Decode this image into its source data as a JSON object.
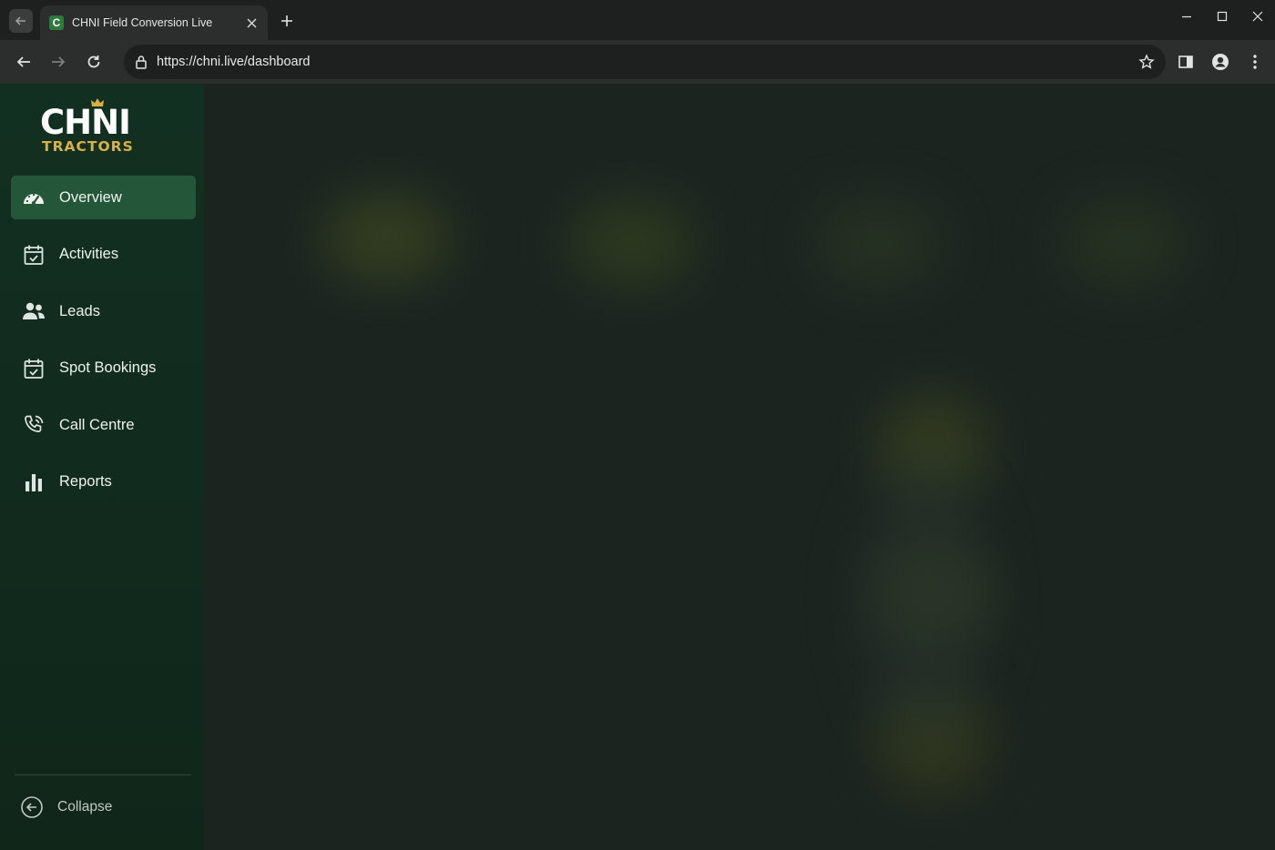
{
  "browser": {
    "tab_title": "CHNI Field Conversion Live",
    "favicon_letter": "C",
    "url": "https://chni.live/dashboard"
  },
  "logo": {
    "line1": "CHNI",
    "line2": "TRACTORS"
  },
  "sidebar": {
    "items": [
      {
        "label": "Overview",
        "icon": "speedometer-icon",
        "active": true
      },
      {
        "label": "Activities",
        "icon": "calendar-check-icon",
        "active": false
      },
      {
        "label": "Leads",
        "icon": "people-icon",
        "active": false
      },
      {
        "label": "Spot Bookings",
        "icon": "calendar-check-icon",
        "active": false
      },
      {
        "label": "Call Centre",
        "icon": "phone-icon",
        "active": false
      },
      {
        "label": "Reports",
        "icon": "bar-chart-icon",
        "active": false
      }
    ],
    "collapse_label": "Collapse"
  },
  "colors": {
    "sidebar_bg": "#123021",
    "active_item_bg": "#24573a",
    "brand_gold": "#d8b04a",
    "main_bg": "#1c2420"
  }
}
